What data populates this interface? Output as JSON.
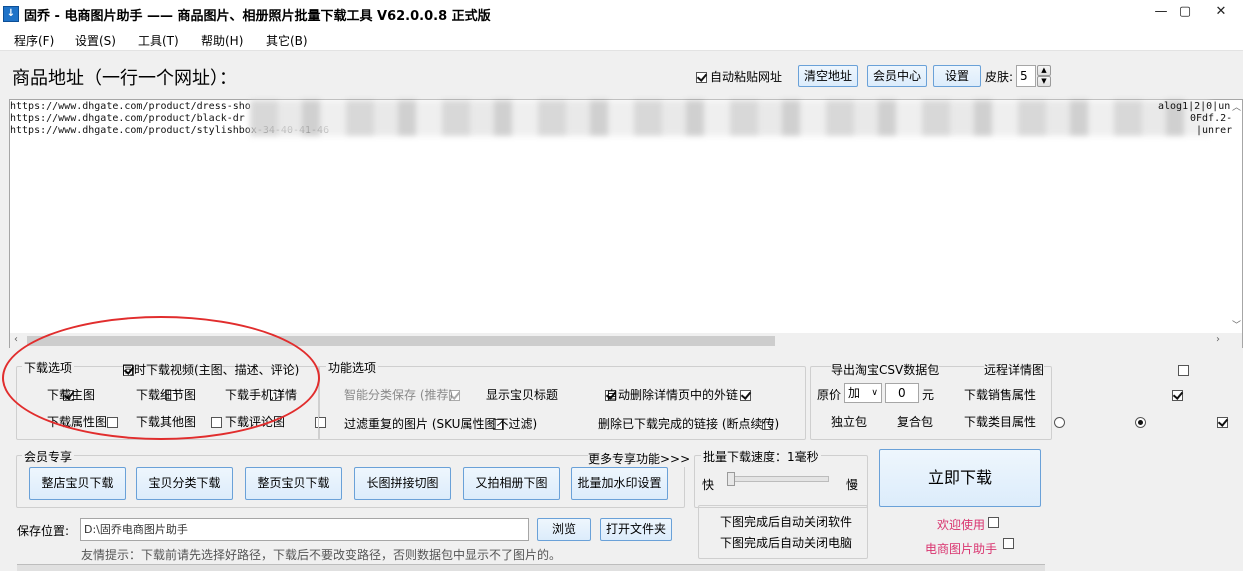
{
  "window": {
    "title": "固乔 - 电商图片助手 —— 商品图片、相册照片批量下载工具 V62.0.0.8 正式版",
    "app_icon": "download-arrow-icon",
    "controls": [
      "minimize-icon",
      "maximize-icon",
      "close-icon"
    ]
  },
  "menu": [
    "程序(F)",
    "设置(S)",
    "工具(T)",
    "帮助(H)",
    "其它(B)"
  ],
  "url_panel": {
    "title": "商品地址（一行一个网址）：",
    "auto_paste_label": "自动粘贴网址",
    "auto_paste_checked": true,
    "clear_button": "清空地址",
    "member_button": "会员中心",
    "settings_button": "设置",
    "skin_label": "皮肤:",
    "skin_value": "5",
    "urls": [
      {
        "start": "https://www.dhgate.com/product/dress-sho",
        "end": "alog1|2|0|un"
      },
      {
        "start": "https://www.dhgate.com/product/black-dr",
        "end": "0Fdf.2-"
      },
      {
        "start": "https://www.dhgate.com/product/stylishbox-34-40-41-46",
        "end": "|unrer"
      }
    ]
  },
  "download_options": {
    "title": "下载选项",
    "video_label": "同时下载视频(主图、描述、评论)",
    "video_checked": true,
    "items": [
      {
        "label": "下载主图",
        "checked": true
      },
      {
        "label": "下载细节图",
        "checked": false
      },
      {
        "label": "下载手机详情",
        "checked": false
      },
      {
        "label": "下载属性图",
        "checked": false
      },
      {
        "label": "下载其他图",
        "checked": false
      },
      {
        "label": "下载评论图",
        "checked": false
      }
    ]
  },
  "function_options": {
    "title": "功能选项",
    "smart_save": {
      "label": "智能分类保存 (推荐)",
      "checked": true,
      "disabled": true
    },
    "show_title": {
      "label": "显示宝贝标题",
      "checked": true
    },
    "auto_delete_links": {
      "label": "自动删除详情页中的外链",
      "checked": true
    },
    "filter_dup": {
      "label": "过滤重复的图片 (SKU属性图不过滤)",
      "checked": false
    },
    "delete_done": {
      "label": "删除已下载完成的链接 (断点续传)",
      "checked": false
    }
  },
  "csv_options": {
    "export_csv": {
      "label": "导出淘宝CSV数据包",
      "checked": true
    },
    "remote_detail": {
      "label": "远程详情图",
      "checked": false
    },
    "price_label": "原价",
    "price_op": "加",
    "price_value": "0",
    "price_unit": "元",
    "sales_attr": {
      "label": "下载销售属性",
      "checked": true
    },
    "single_pack": {
      "label": "独立包",
      "selected": false
    },
    "combined_pack": {
      "label": "复合包",
      "selected": true
    },
    "category_attr": {
      "label": "下载类目属性",
      "checked": true
    }
  },
  "member": {
    "title": "会员专享",
    "more_link": "更多专享功能>>>",
    "buttons": [
      "整店宝贝下载",
      "宝贝分类下载",
      "整页宝贝下载",
      "长图拼接切图",
      "又拍相册下图",
      "批量加水印设置"
    ]
  },
  "speed": {
    "label": "批量下载速度：1毫秒",
    "fast": "快",
    "slow": "慢",
    "level": 0
  },
  "after_download": {
    "close_app": {
      "label": "下图完成后自动关闭软件",
      "checked": false
    },
    "shutdown": {
      "label": "下图完成后自动关闭电脑",
      "checked": false
    }
  },
  "download_button": "立即下载",
  "welcome": [
    "欢迎使用",
    "电商图片助手"
  ],
  "save": {
    "label": "保存位置:",
    "path": "D:\\固乔电商图片助手",
    "browse_button": "浏览",
    "open_folder_button": "打开文件夹",
    "tip": "友情提示：下载前请先选择好路径，下载后不要改变路径，否则数据包中显示不了图片的。"
  }
}
